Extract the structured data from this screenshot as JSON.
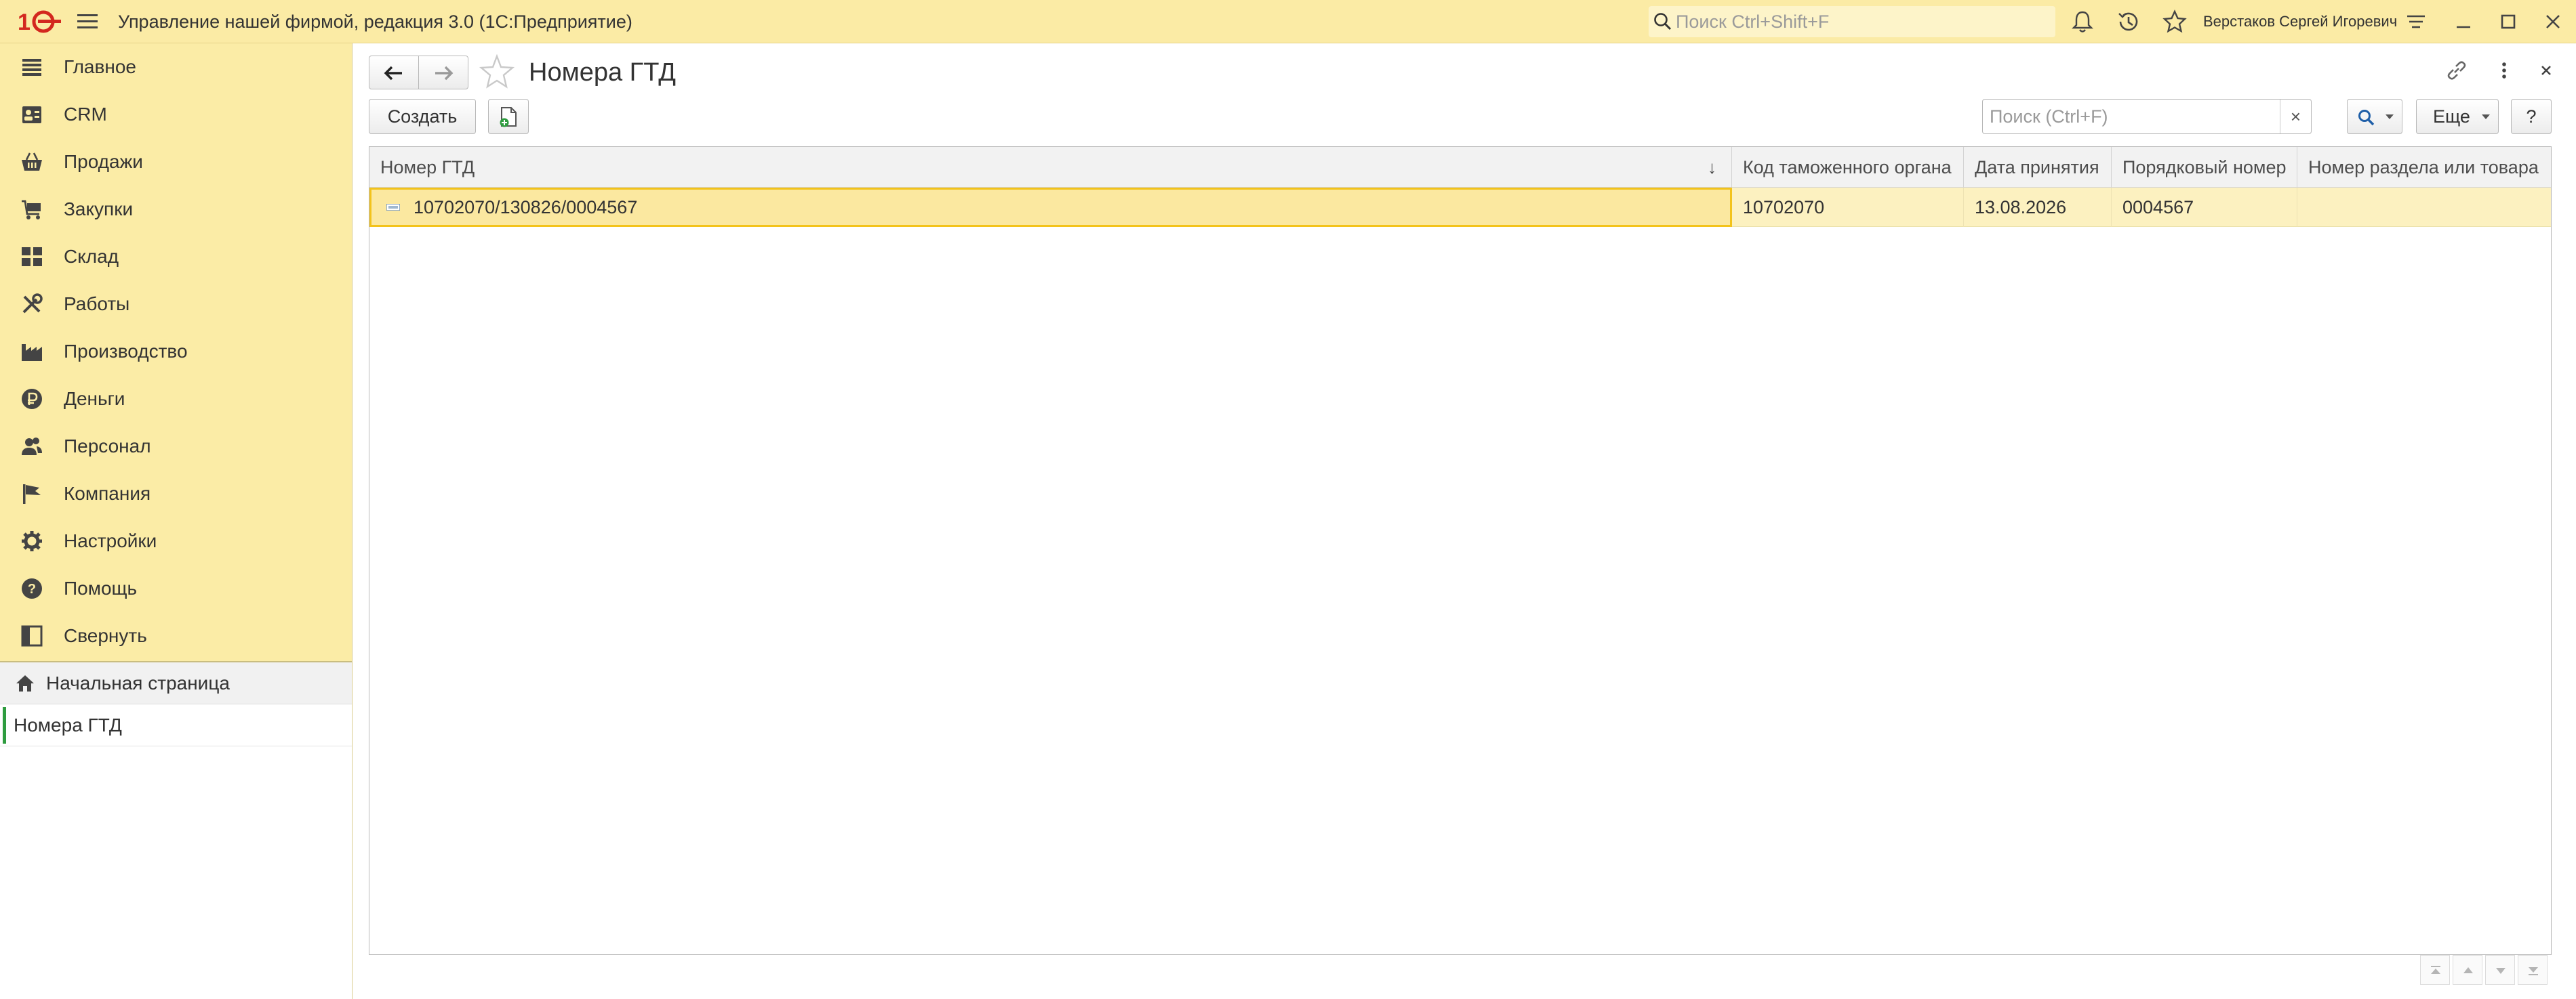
{
  "app": {
    "title": "Управление нашей фирмой, редакция 3.0  (1С:Предприятие)",
    "logo_icon": "1c-logo-icon",
    "search_placeholder": "Поиск Ctrl+Shift+F",
    "user": "Верстаков Сергей Игоревич",
    "accent_color": "#fbeba5"
  },
  "sidebar": {
    "items": [
      {
        "label": "Главное",
        "icon": "list-icon"
      },
      {
        "label": "CRM",
        "icon": "contacts-icon"
      },
      {
        "label": "Продажи",
        "icon": "basket-icon"
      },
      {
        "label": "Закупки",
        "icon": "cart-icon"
      },
      {
        "label": "Склад",
        "icon": "warehouse-icon"
      },
      {
        "label": "Работы",
        "icon": "tools-icon"
      },
      {
        "label": "Производство",
        "icon": "factory-icon"
      },
      {
        "label": "Деньги",
        "icon": "ruble-icon"
      },
      {
        "label": "Персонал",
        "icon": "people-icon"
      },
      {
        "label": "Компания",
        "icon": "flag-icon"
      },
      {
        "label": "Настройки",
        "icon": "gear-icon"
      },
      {
        "label": "Помощь",
        "icon": "help-icon"
      },
      {
        "label": "Свернуть",
        "icon": "collapse-icon"
      }
    ],
    "home": "Начальная страница",
    "open_windows": [
      {
        "label": "Номера ГТД"
      }
    ]
  },
  "page": {
    "title": "Номера ГТД",
    "create_label": "Создать",
    "search_placeholder": "Поиск (Ctrl+F)",
    "search_clear": "×",
    "more_label": "Еще",
    "help_label": "?"
  },
  "table": {
    "columns": [
      "Номер ГТД",
      "Код таможенного органа",
      "Дата принятия",
      "Порядковый номер",
      "Номер раздела или товара"
    ],
    "sort_indicator": "↓",
    "rows": [
      {
        "number": "10702070/130826/0004567",
        "customs_code": "10702070",
        "date": "13.08.2026",
        "serial": "0004567",
        "section": ""
      }
    ]
  }
}
